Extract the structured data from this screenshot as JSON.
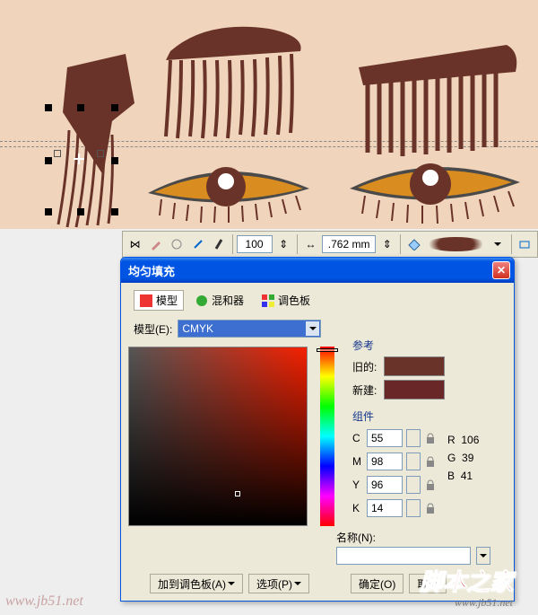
{
  "toolbar": {
    "val1": "100",
    "val2": ".762 mm"
  },
  "dialog": {
    "title": "均匀填充",
    "tabs": {
      "model": "模型",
      "mixer": "混和器",
      "palette": "调色板"
    },
    "model_label": "模型(E):",
    "model_value": "CMYK",
    "ref_label": "参考",
    "old_label": "旧的:",
    "new_label": "新建:",
    "comp_label": "组件",
    "c_label": "C",
    "c_val": "55",
    "m_label": "M",
    "m_val": "98",
    "y_label": "Y",
    "y_val": "96",
    "k_label": "K",
    "k_val": "14",
    "r_label": "R",
    "r_val": "106",
    "g_label": "G",
    "g_val": "39",
    "b_label": "B",
    "b_val": "41",
    "name_label": "名称(N):",
    "add_palette": "加到调色板(A)",
    "options": "选项(P)",
    "ok": "确定(O)",
    "cancel": "取消"
  },
  "swatch_old": "#6a3329",
  "swatch_new": "#6a2727",
  "watermark": {
    "w1": "www.jb51.net",
    "w2": "脚本之家",
    "w3": "www.jb51.net"
  }
}
